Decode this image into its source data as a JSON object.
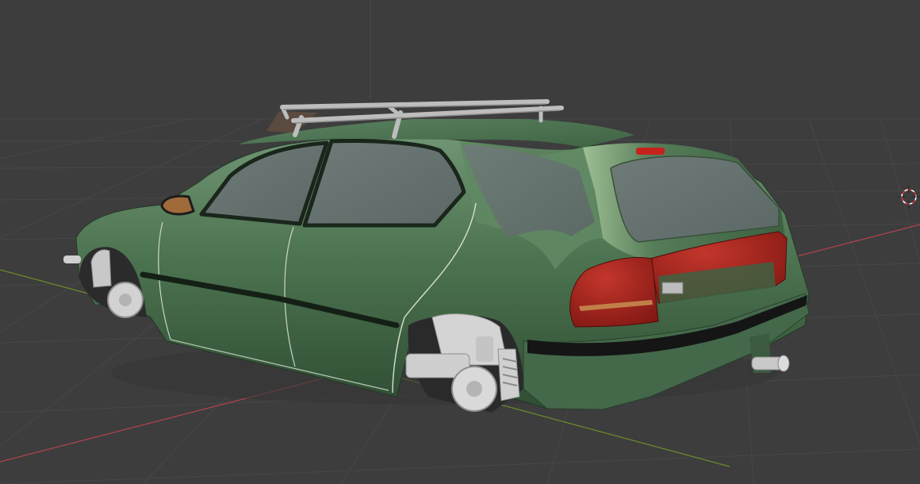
{
  "viewport": {
    "background_color": "#3d3d3d",
    "grid_color": "#474747",
    "x_axis_color": "#b1444e",
    "y_axis_color": "#6b8d2b",
    "z_axis_color": "#4a4a4a"
  },
  "scene": {
    "object": "car-model",
    "body_color": "#4d7451",
    "window_color": "#6b7774",
    "taillight_color": "#a3231f",
    "chrome_color": "#c4c4c4",
    "cursor_icon": "3d-cursor-icon"
  }
}
